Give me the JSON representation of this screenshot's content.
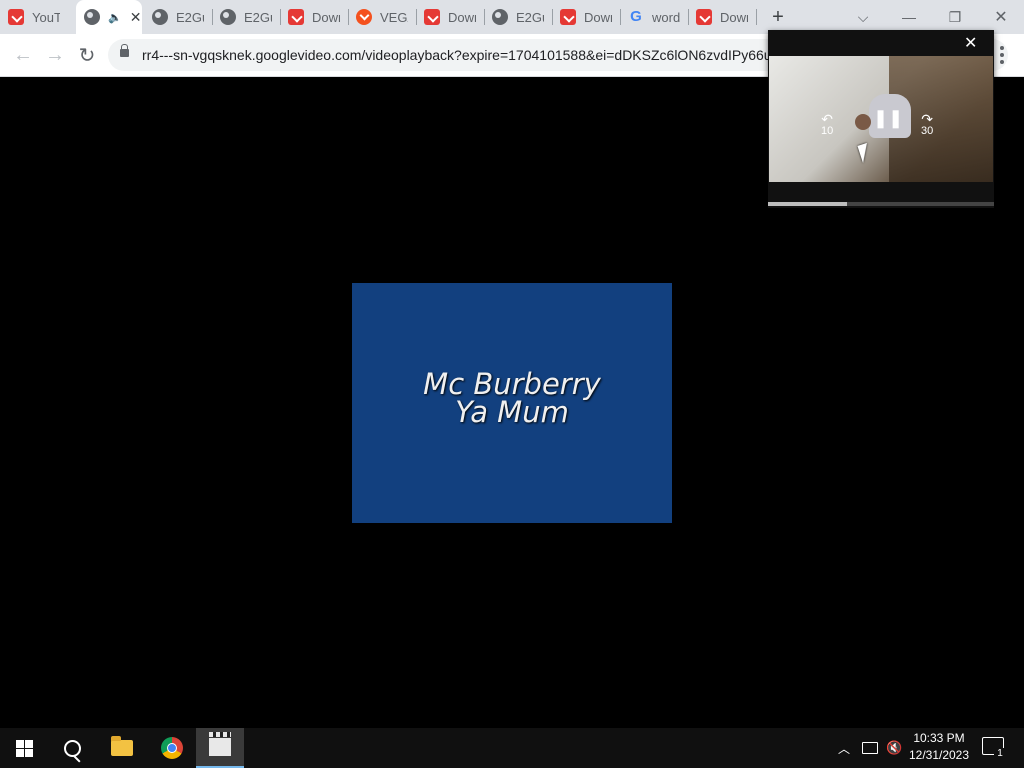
{
  "browser": {
    "tabs": [
      {
        "title": "YouT",
        "icon": "download-red-icon"
      },
      {
        "title": "",
        "icon": "globe-icon"
      },
      {
        "title": "E2Gu",
        "icon": "globe-icon"
      },
      {
        "title": "E2Gu",
        "icon": "globe-icon"
      },
      {
        "title": "Dowr",
        "icon": "download-red-icon"
      },
      {
        "title": "VEGA",
        "icon": "download-orange-icon"
      },
      {
        "title": "Dowr",
        "icon": "download-red-icon"
      },
      {
        "title": "E2Gu",
        "icon": "globe-icon"
      },
      {
        "title": "Dowr",
        "icon": "download-red-icon"
      },
      {
        "title": "word",
        "icon": "google-icon"
      },
      {
        "title": "Dowr",
        "icon": "download-red-icon"
      }
    ],
    "new_tab_symbol": "+",
    "url": "rr4---sn-vgqsknek.googlevideo.com/videoplayback?expire=1704101588&ei=dDKSZc6lON6zvdIPy66u"
  },
  "video": {
    "line1": "Mc Burberry",
    "line2": "Ya Mum"
  },
  "pip": {
    "rewind_seconds": "10",
    "forward_seconds": "30",
    "progress": 0.35
  },
  "taskbar": {
    "time": "10:33 PM",
    "date": "12/31/2023",
    "notification_count": "1"
  },
  "colors": {
    "video_background": "#12407f",
    "accent": "#76b9ed"
  }
}
